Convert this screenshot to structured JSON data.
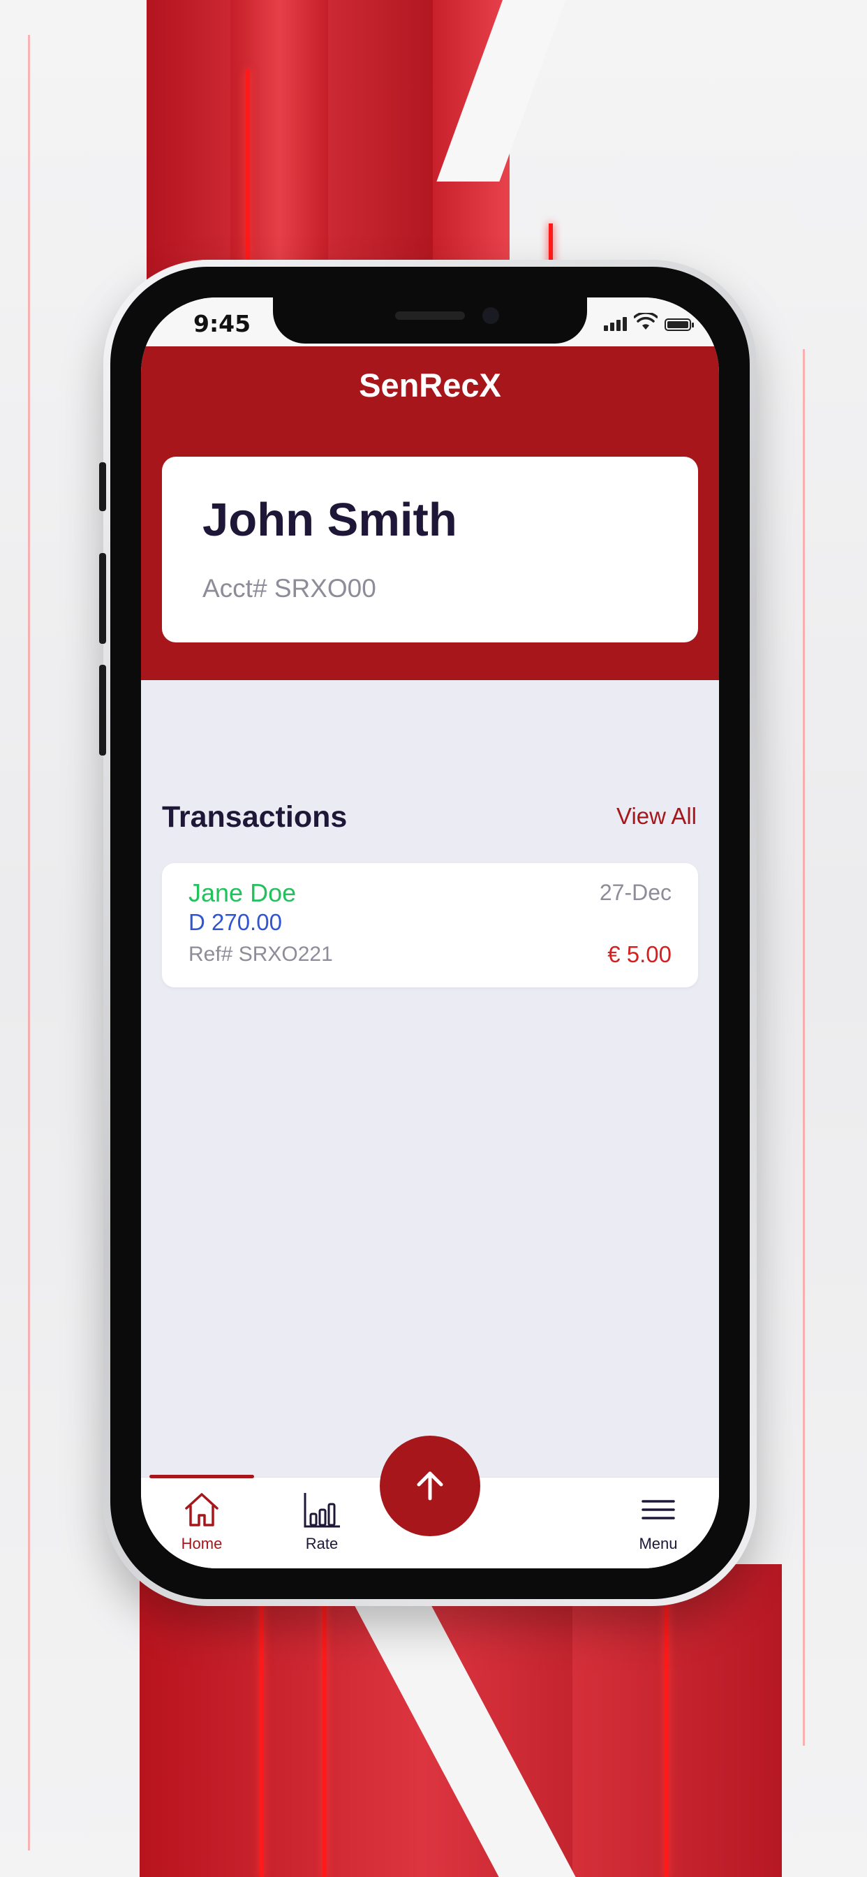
{
  "status_bar": {
    "time": "9:45"
  },
  "app": {
    "title": "SenRecX",
    "brand_color": "#a6161a"
  },
  "account": {
    "name": "John Smith",
    "account_number": "Acct# SRXO00"
  },
  "transactions": {
    "title": "Transactions",
    "view_all_label": "View All",
    "items": [
      {
        "name": "Jane Doe",
        "date": "27-Dec",
        "amount": "D 270.00",
        "reference": "Ref# SRXO221",
        "fee": "€ 5.00"
      }
    ]
  },
  "tabbar": {
    "home_label": "Home",
    "home_icon": "home-icon",
    "rate_label": "Rate",
    "rate_icon": "bar-chart-icon",
    "send_icon": "arrow-up-icon",
    "menu_label": "Menu",
    "menu_icon": "hamburger-menu-icon"
  }
}
